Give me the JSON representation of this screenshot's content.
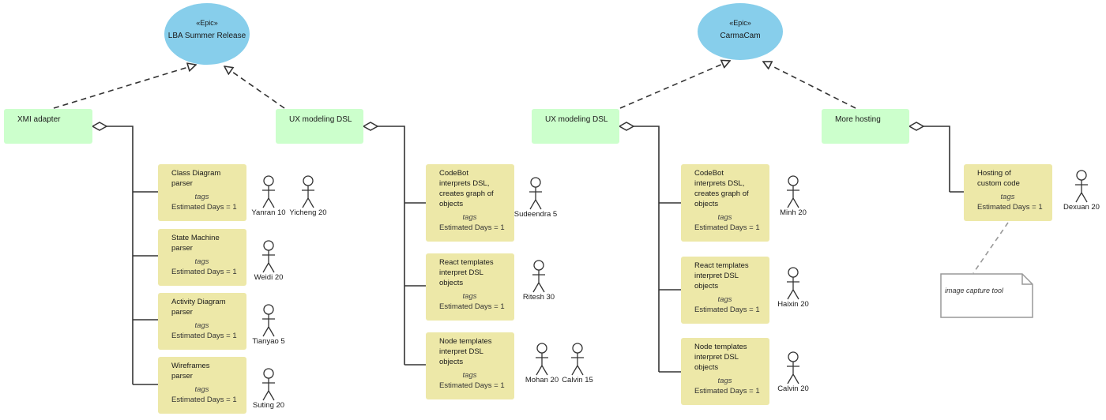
{
  "diagram": {
    "colors": {
      "epic": "#87ceeb",
      "feature": "#ccffcc",
      "story": "#ede8a8",
      "line": "#333333",
      "note_border": "#999999"
    },
    "epics": [
      {
        "stereotype": "«Epic»",
        "name": "LBA Summer Release",
        "features": [
          {
            "name": "XMI adapter",
            "stories": [
              {
                "title": "Class Diagram\nparser",
                "tags": "tags",
                "estimate": "Estimated Days = 1",
                "actors": [
                  {
                    "name": "Yanran 10"
                  },
                  {
                    "name": "Yicheng 20"
                  }
                ]
              },
              {
                "title": "State Machine\nparser",
                "tags": "tags",
                "estimate": "Estimated Days = 1",
                "actors": [
                  {
                    "name": "Weidi 20"
                  }
                ]
              },
              {
                "title": "Activity Diagram\nparser",
                "tags": "tags",
                "estimate": "Estimated Days = 1",
                "actors": [
                  {
                    "name": "Tianyao 5"
                  }
                ]
              },
              {
                "title": "Wireframes\nparser",
                "tags": "tags",
                "estimate": "Estimated Days = 1",
                "actors": [
                  {
                    "name": "Suting 20"
                  }
                ]
              }
            ]
          },
          {
            "name": "UX modeling DSL",
            "stories": [
              {
                "title": "CodeBot\ninterprets DSL,\ncreates graph of\nobjects",
                "tags": "tags",
                "estimate": "Estimated Days = 1",
                "actors": [
                  {
                    "name": "Sudeendra 5"
                  }
                ]
              },
              {
                "title": "React templates\ninterpret DSL\nobjects",
                "tags": "tags",
                "estimate": "Estimated Days = 1",
                "actors": [
                  {
                    "name": "Ritesh 30"
                  }
                ]
              },
              {
                "title": "Node templates\ninterpret DSL\nobjects",
                "tags": "tags",
                "estimate": "Estimated Days = 1",
                "actors": [
                  {
                    "name": "Mohan 20"
                  },
                  {
                    "name": "Calvin 15"
                  }
                ]
              }
            ]
          }
        ]
      },
      {
        "stereotype": "«Epic»",
        "name": "CarmaCam",
        "features": [
          {
            "name": "UX modeling DSL",
            "stories": [
              {
                "title": "CodeBot\ninterprets DSL,\ncreates graph of\nobjects",
                "tags": "tags",
                "estimate": "Estimated Days = 1",
                "actors": [
                  {
                    "name": "Minh 20"
                  }
                ]
              },
              {
                "title": "React templates\ninterpret DSL\nobjects",
                "tags": "tags",
                "estimate": "Estimated Days = 1",
                "actors": [
                  {
                    "name": "Haixin 20"
                  }
                ]
              },
              {
                "title": "Node templates\ninterpret DSL\nobjects",
                "tags": "tags",
                "estimate": "Estimated Days = 1",
                "actors": [
                  {
                    "name": "Calvin 20"
                  }
                ]
              }
            ]
          },
          {
            "name": "More hosting",
            "stories": [
              {
                "title": "Hosting of\ncustom code",
                "tags": "tags",
                "estimate": "Estimated Days = 1",
                "actors": [
                  {
                    "name": "Dexuan 20"
                  }
                ]
              }
            ]
          }
        ]
      }
    ],
    "notes": [
      {
        "text": "image capture tool"
      }
    ]
  }
}
